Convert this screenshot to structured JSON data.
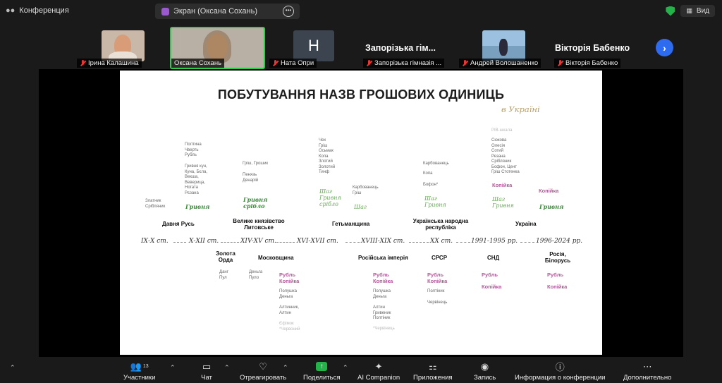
{
  "window": {
    "title": "Конференция",
    "share_label": "Экран (Оксана Сохань)",
    "view_label": "Вид"
  },
  "participants": [
    {
      "name": "Ірина Калашина",
      "muted": true
    },
    {
      "name": "Оксана Сохань",
      "muted": false,
      "active": true
    },
    {
      "name": "Ната Опри",
      "muted": true,
      "initial": "Н"
    },
    {
      "name": "Запорізька гімназія ...",
      "big_name": "Запорізька гім...",
      "muted": true
    },
    {
      "name": "Андрей Волошаненко",
      "muted": true
    },
    {
      "name": "Вікторія Бабенко",
      "big_name": "Вікторія Бабенко",
      "muted": true
    }
  ],
  "slide": {
    "title": "ПОБУТУВАННЯ НАЗВ ГРОШОВИХ ОДИНИЦЬ",
    "subtitle": "в Україні",
    "centuries": [
      "ІХ-Х ст.",
      "Х-ХІІ ст.",
      "ХІV-ХV ст.",
      "ХVІ-ХVІІ ст.",
      "ХVІІІ-ХІХ ст.",
      "ХХ ст.",
      "1991-1995 рр.",
      "1996-2024 рр."
    ],
    "states_top": [
      "Давня Русь",
      "Велике князівство Литовське",
      "Гетьманщина",
      "Українська народна республіка",
      "Україна"
    ],
    "states_bottom": [
      "Золота Орда",
      "Московщина",
      "Російська імперія",
      "СРСР",
      "СНД",
      "Росія, Білорусь"
    ],
    "col1": {
      "small": "Златник\nСрібляник"
    },
    "col2": {
      "small1": "Полтина\nЧверть\nРубль",
      "small2": "Гривня кун,\nКуна, Бєла,\nВекша,\nВеверица,\nНогата\nРєзана",
      "green": "Гривня"
    },
    "col3": {
      "small1": "Гріш, Грошик",
      "small2": "Пенязь\nДенарій",
      "green": "Гривня\nсрібло"
    },
    "col4": {
      "small": "Чех\nГріш\nОсьмак\nКопа\nЗлотий\nЗолотий\nТинф",
      "green": "Шаг\nГривня\nсрібло"
    },
    "col5": {
      "small": "Карбованець\nГріш",
      "green": "Шаг"
    },
    "col6": {
      "small1": "Карбованець",
      "small2": "Копа",
      "small3": "Бофон*",
      "green": "Шаг\nГривня"
    },
    "col7": {
      "faint": "РІВ-шкала",
      "small": "Сюкова\nОлесія\nСотий\nРезана\nСрібляник\nБофон, Цент\nГріш Стотенка",
      "pink": "Копійка",
      "green": "Шаг\nГривня"
    },
    "col8": {
      "pink": "Копійка",
      "green": "Гривня"
    },
    "bottom_zo": "Данг\nПул",
    "bottom_mos": "Деньга\nПуло",
    "bottom_mos2": {
      "pink": "Рубль\nКопійка",
      "small1": "Полушка\nДеньга",
      "small2": "Алтинник,\nАлтин",
      "faint": "Єфімок\n*Червоний"
    },
    "bottom_ri": {
      "pink": "Рубль\nКопійка",
      "small1": "Полушка\nДеньга",
      "small2": "Алтин\nГривеник\nПолтіник",
      "faint": "*Червінець"
    },
    "bottom_ussr": {
      "pink": "Рубль\nКопійка",
      "small1": "Полтіник",
      "small2": "Червінець"
    },
    "bottom_snd": {
      "pink1": "Рубль",
      "pink2": "Копійка"
    },
    "bottom_rb": {
      "pink1": "Рубль",
      "pink2": "Копійка"
    }
  },
  "toolbar": [
    {
      "label": "Участники",
      "count": "13"
    },
    {
      "label": "Чат"
    },
    {
      "label": "Отреагировать"
    },
    {
      "label": "Поделиться"
    },
    {
      "label": "AI Companion"
    },
    {
      "label": "Приложения"
    },
    {
      "label": "Запись"
    },
    {
      "label": "Информация о конференции"
    },
    {
      "label": "Дополнительно"
    }
  ],
  "colors": {
    "accent_green": "#24b24a",
    "accent_blue": "#2d6cf0",
    "pink": "#b35a9a",
    "green_text": "#3a8a3a"
  }
}
